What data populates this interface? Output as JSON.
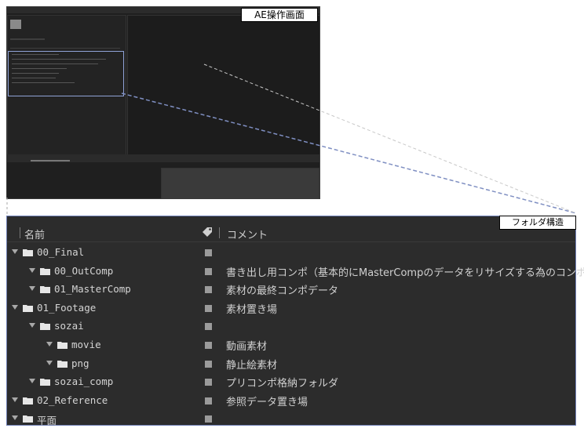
{
  "labels": {
    "ae_screen": "AE操作画面",
    "folder_structure": "フォルダ構造"
  },
  "header": {
    "name_col": "名前",
    "label_col_icon": "tag-icon",
    "comment_col": "コメント"
  },
  "rows": [
    {
      "level": 0,
      "name": "00_Final",
      "comment": ""
    },
    {
      "level": 1,
      "name": "00_OutComp",
      "comment": "書き出し用コンポ（基本的にMasterCompのデータをリサイズする為のコンポ）"
    },
    {
      "level": 1,
      "name": "01_MasterComp",
      "comment": "素材の最終コンポデータ"
    },
    {
      "level": 0,
      "name": "01_Footage",
      "comment": "素材置き場"
    },
    {
      "level": 1,
      "name": "sozai",
      "comment": ""
    },
    {
      "level": 2,
      "name": "movie",
      "comment": "動画素材"
    },
    {
      "level": 2,
      "name": "png",
      "comment": "静止絵素材"
    },
    {
      "level": 1,
      "name": "sozai_comp",
      "comment": "プリコンポ格納フォルダ"
    },
    {
      "level": 0,
      "name": "02_Reference",
      "comment": "参照データ置き場"
    },
    {
      "level": 0,
      "name": "平面",
      "comment": ""
    }
  ],
  "colors": {
    "panel_bg": "#2c2c2c",
    "selection_border": "#6f7fb5",
    "label_swatch": "#9b9b9b"
  }
}
